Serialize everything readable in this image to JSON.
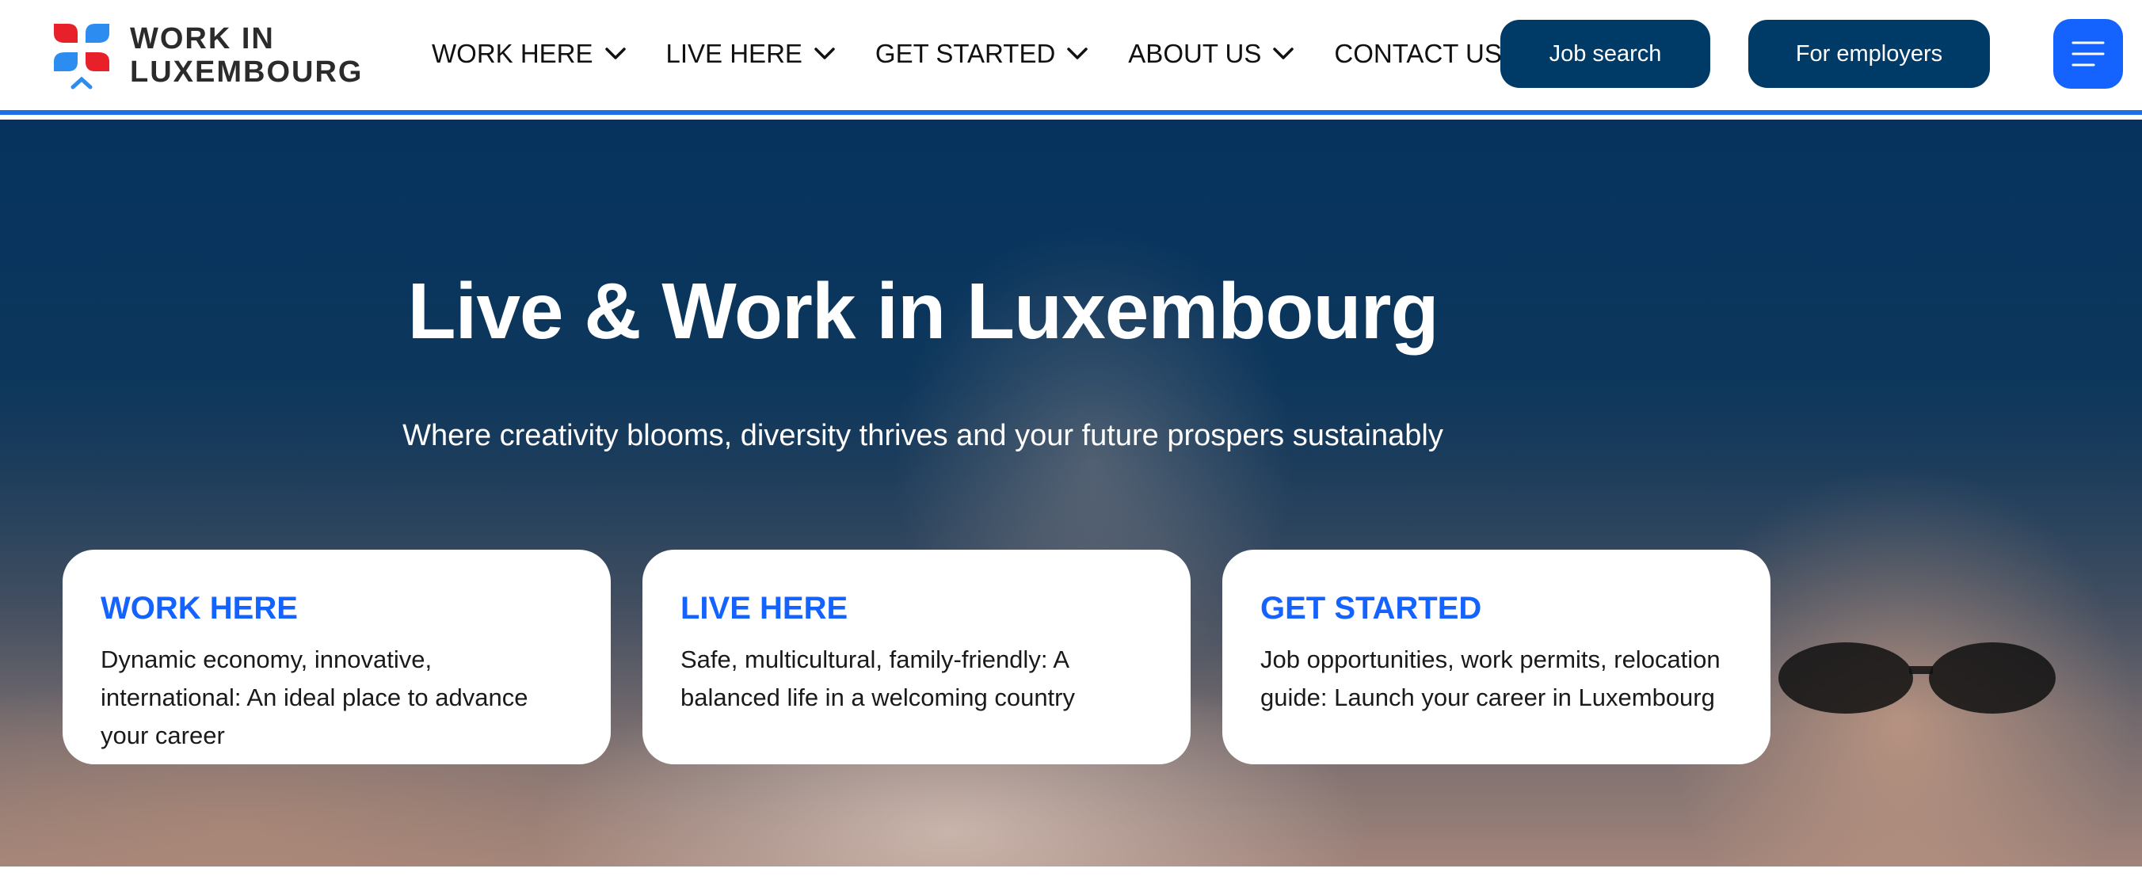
{
  "header": {
    "logo": {
      "line1": "WORK IN",
      "line2": "LUXEMBOURG"
    },
    "nav": [
      {
        "label": "WORK HERE"
      },
      {
        "label": "LIVE HERE"
      },
      {
        "label": "GET STARTED"
      },
      {
        "label": "ABOUT US"
      },
      {
        "label": "CONTACT US"
      }
    ],
    "job_search_label": "Job search",
    "employers_label": "For employers",
    "menu_icon": "hamburger-menu-icon"
  },
  "hero": {
    "title": "Live & Work in Luxembourg",
    "subtitle": "Where creativity blooms, diversity thrives and your future prospers sustainably",
    "cards": [
      {
        "title": "WORK HERE",
        "description": "Dynamic economy, innovative, international: An ideal place to advance your career"
      },
      {
        "title": "LIVE HERE",
        "description": "Safe, multicultural, family-friendly: A balanced life in a welcoming country"
      },
      {
        "title": "GET STARTED",
        "description": "Job opportunities, work permits, relocation guide: Launch your career in Luxembourg"
      }
    ]
  },
  "colors": {
    "brand_dark": "#003a66",
    "accent_blue": "#1463ff",
    "logo_red": "#e8202a",
    "logo_blue": "#2d8cf0"
  }
}
